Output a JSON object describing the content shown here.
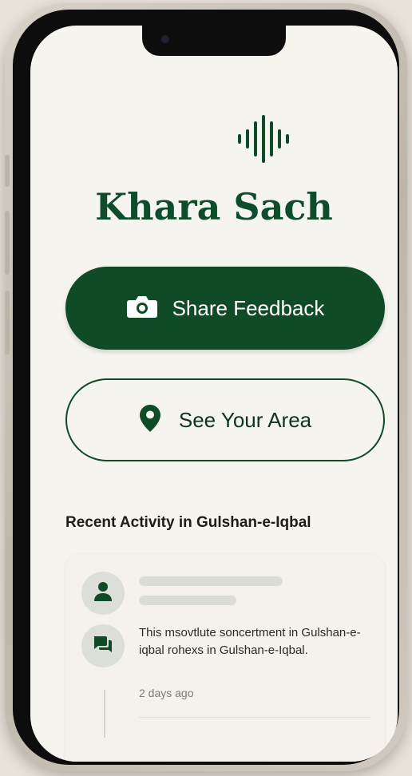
{
  "app": {
    "title": "Khara Sach",
    "logo_icon": "audio-waveform-icon",
    "brand_color": "#0f4b27"
  },
  "actions": {
    "share_feedback_label": "Share Feedback",
    "share_feedback_icon": "camera-icon",
    "see_area_label": "See Your Area",
    "see_area_icon": "location-pin-icon"
  },
  "recent": {
    "title": "Recent Activity in Gulshan-e-Iqbal",
    "items": [
      {
        "icon": "chat-icon",
        "text": "This msovtlute soncertment in Gulshan-e-iqbal rohexs in Gulshan-e-Iqbal.",
        "time": "2 days ago"
      }
    ]
  }
}
